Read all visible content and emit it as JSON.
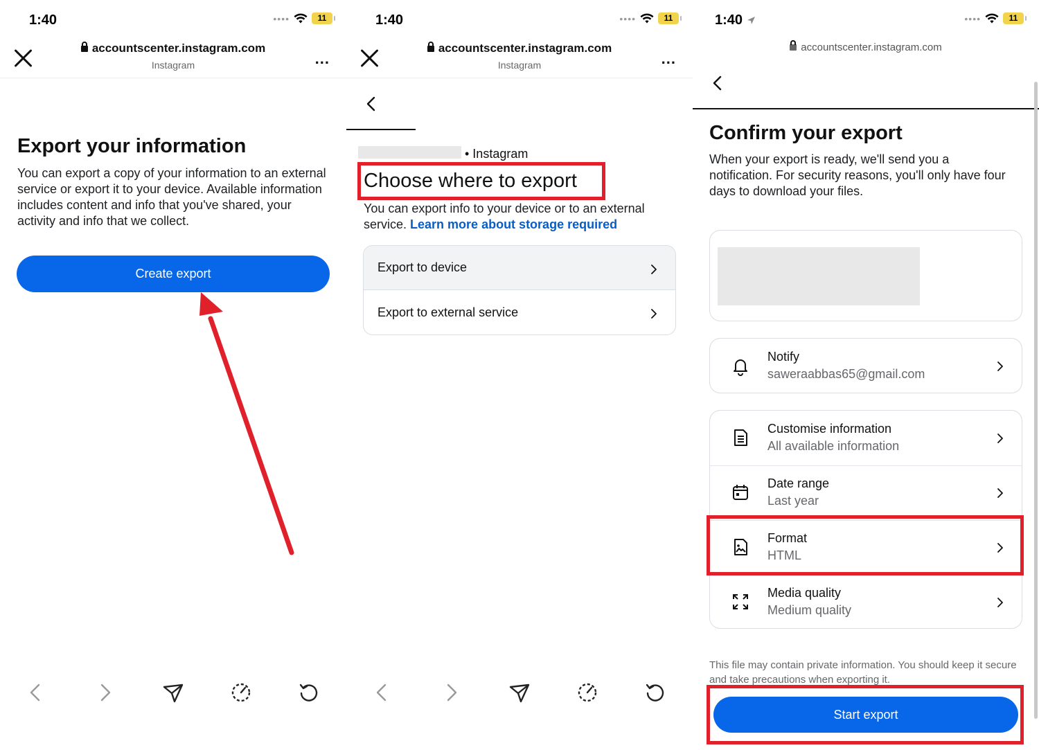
{
  "panels": [
    {
      "status": {
        "time": "1:40",
        "battery": "11"
      },
      "browser": {
        "url": "accountscenter.instagram.com",
        "site": "Instagram",
        "more": "..."
      },
      "title": "Export your information",
      "description": "You can export a copy of your information to an external service or export it to your device. Available information includes content and info that you've shared, your activity and info that we collect.",
      "primary_button": "Create export"
    },
    {
      "status": {
        "time": "1:40",
        "battery": "11"
      },
      "browser": {
        "url": "accountscenter.instagram.com",
        "site": "Instagram",
        "more": "..."
      },
      "account_suffix": "• Instagram",
      "title": "Choose where to export",
      "description": "You can export info to your device or to an external service.",
      "link": "Learn more about storage required",
      "options": [
        {
          "label": "Export to device"
        },
        {
          "label": "Export to external service"
        }
      ]
    },
    {
      "status": {
        "time": "1:40",
        "battery": "11"
      },
      "browser": {
        "url": "accountscenter.instagram.com"
      },
      "title": "Confirm your export",
      "description": "When your export is ready, we'll send you a notification. For security reasons, you'll only have four days to download your files.",
      "notify": {
        "title": "Notify",
        "value": "saweraabbas65@gmail.com",
        "icon": "bell-icon"
      },
      "settings": [
        {
          "title": "Customise information",
          "value": "All available information",
          "icon": "document-icon"
        },
        {
          "title": "Date range",
          "value": "Last year",
          "icon": "calendar-icon"
        },
        {
          "title": "Format",
          "value": "HTML",
          "icon": "file-image-icon"
        },
        {
          "title": "Media quality",
          "value": "Medium quality",
          "icon": "expand-icon"
        }
      ],
      "note": "This file may contain private information. You should keep it secure and take precautions when exporting it.",
      "primary_button": "Start export"
    }
  ],
  "colors": {
    "primary_blue": "#0866e8",
    "annotation_red": "#e0202a",
    "link_blue": "#0a5dc2"
  }
}
